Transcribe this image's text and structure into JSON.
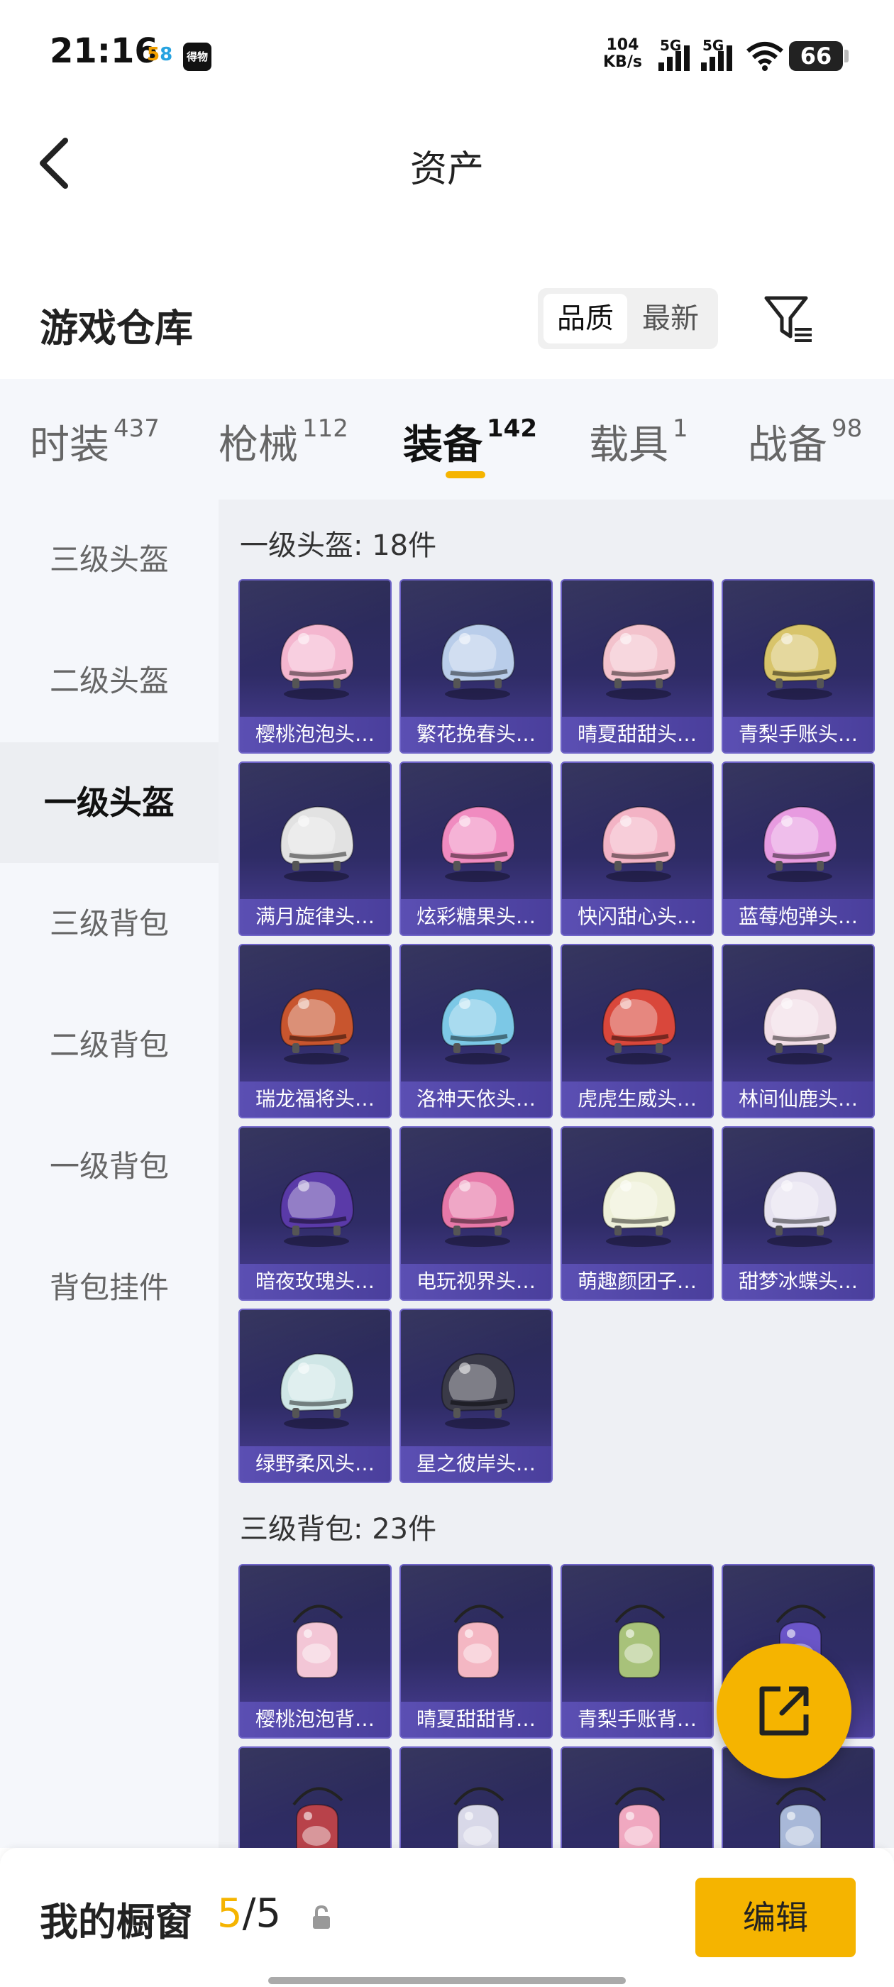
{
  "status": {
    "time": "21:16",
    "app_badge_a": [
      "5",
      "8"
    ],
    "app_badge_b": "得物",
    "net_speed_value": "104",
    "net_speed_unit": "KB/s",
    "sim1": "5G",
    "sim2": "5G",
    "battery": "66"
  },
  "nav": {
    "title": "资产"
  },
  "header": {
    "title": "游戏仓库",
    "sort_options": [
      "品质",
      "最新"
    ],
    "active_sort": "品质"
  },
  "tabs": [
    {
      "label": "时装",
      "count": "437"
    },
    {
      "label": "枪械",
      "count": "112"
    },
    {
      "label": "装备",
      "count": "142"
    },
    {
      "label": "载具",
      "count": "1"
    },
    {
      "label": "战备",
      "count": "98"
    }
  ],
  "active_tab": "装备",
  "sidebar": [
    {
      "label": "三级头盔"
    },
    {
      "label": "二级头盔"
    },
    {
      "label": "一级头盔"
    },
    {
      "label": "三级背包"
    },
    {
      "label": "二级背包"
    },
    {
      "label": "一级背包"
    },
    {
      "label": "背包挂件"
    }
  ],
  "active_sidebar": "一级头盔",
  "sections": [
    {
      "title": "一级头盔: 18件",
      "items": [
        {
          "name": "樱桃泡泡头…",
          "icon": "helmet-icon",
          "color": "#f4b6cf"
        },
        {
          "name": "繁花挽春头…",
          "icon": "helmet-icon",
          "color": "#b9cdea"
        },
        {
          "name": "晴夏甜甜头…",
          "icon": "helmet-icon",
          "color": "#f3c2cc"
        },
        {
          "name": "青梨手账头…",
          "icon": "helmet-icon",
          "color": "#d8c46a"
        },
        {
          "name": "满月旋律头…",
          "icon": "helmet-icon",
          "color": "#e2e2e2"
        },
        {
          "name": "炫彩糖果头…",
          "icon": "helmet-icon",
          "color": "#f08bc0"
        },
        {
          "name": "快闪甜心头…",
          "icon": "helmet-icon",
          "color": "#f3b3c5"
        },
        {
          "name": "蓝莓炮弹头…",
          "icon": "helmet-icon",
          "color": "#e79be0"
        },
        {
          "name": "瑞龙福将头…",
          "icon": "helmet-icon",
          "color": "#c8552e"
        },
        {
          "name": "洛神天依头…",
          "icon": "helmet-icon",
          "color": "#7cc8e6"
        },
        {
          "name": "虎虎生威头…",
          "icon": "helmet-icon",
          "color": "#d9473b"
        },
        {
          "name": "林间仙鹿头…",
          "icon": "helmet-icon",
          "color": "#f1dde6"
        },
        {
          "name": "暗夜玫瑰头…",
          "icon": "helmet-icon",
          "color": "#5a3aa8"
        },
        {
          "name": "电玩视界头…",
          "icon": "helmet-icon",
          "color": "#e678a8"
        },
        {
          "name": "萌趣颜团子…",
          "icon": "helmet-icon",
          "color": "#eef0d8"
        },
        {
          "name": "甜梦冰蝶头…",
          "icon": "helmet-icon",
          "color": "#e6e2f0"
        },
        {
          "name": "绿野柔风头…",
          "icon": "helmet-icon",
          "color": "#cfe6e6"
        },
        {
          "name": "星之彼岸头…",
          "icon": "helmet-icon",
          "color": "#3a3a48"
        }
      ]
    },
    {
      "title": "三级背包: 23件",
      "items": [
        {
          "name": "樱桃泡泡背…",
          "icon": "backpack-icon",
          "color": "#f3c6d6"
        },
        {
          "name": "晴夏甜甜背…",
          "icon": "backpack-icon",
          "color": "#f4b7c3"
        },
        {
          "name": "青梨手账背…",
          "icon": "backpack-icon",
          "color": "#a8c27a"
        },
        {
          "name": "",
          "icon": "backpack-icon",
          "color": "#6a55c8"
        },
        {
          "name": "",
          "icon": "backpack-icon",
          "color": "#b8424a"
        },
        {
          "name": "",
          "icon": "backpack-icon",
          "color": "#d8d8e8"
        },
        {
          "name": "",
          "icon": "backpack-icon",
          "color": "#f0a8c0"
        },
        {
          "name": "",
          "icon": "backpack-icon",
          "color": "#a8b8d8"
        }
      ]
    }
  ],
  "bottom": {
    "label": "我的橱窗",
    "current": "5",
    "total": "/5",
    "edit": "编辑"
  },
  "colors": {
    "accent": "#f5b400",
    "card_top": "#2a2a55",
    "card_bottom": "#4b3f98"
  }
}
